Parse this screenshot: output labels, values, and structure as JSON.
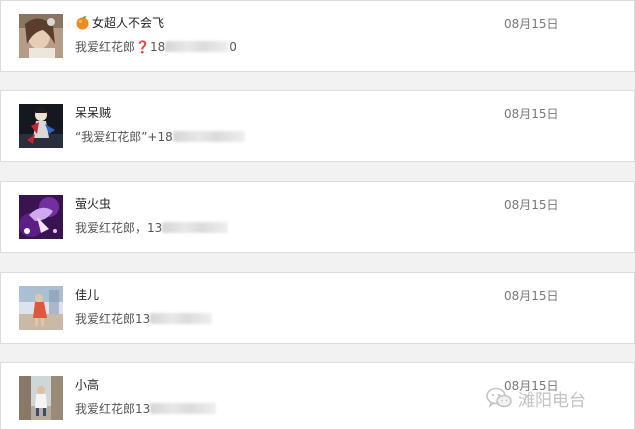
{
  "contacts": [
    {
      "name": "女超人不会飞",
      "emoji": "orange-emoji",
      "message_prefix": "我爱红花郎",
      "message_mark": "❓",
      "message_suffix": "18",
      "message_tail": "0",
      "date": "08月15日"
    },
    {
      "name": "呆呆贼",
      "message_prefix": "“我爱红花郎”+18",
      "date": "08月15日"
    },
    {
      "name": "萤火虫",
      "message_prefix": "我爱红花郎，13",
      "date": "08月15日"
    },
    {
      "name": "佳儿",
      "message_prefix": "我爱红花郎13",
      "date": "08月15日"
    },
    {
      "name": "小高",
      "message_prefix": "我爱红花郎13",
      "date": "08月15日"
    }
  ],
  "watermark": {
    "text": "滩阳电台",
    "icon": "wechat-icon"
  },
  "colors": {
    "background": "#f2f2f2",
    "card": "#ffffff",
    "border": "#dcdcdc",
    "question_mark": "#d9262b",
    "watermark": "#c3c3c3"
  }
}
